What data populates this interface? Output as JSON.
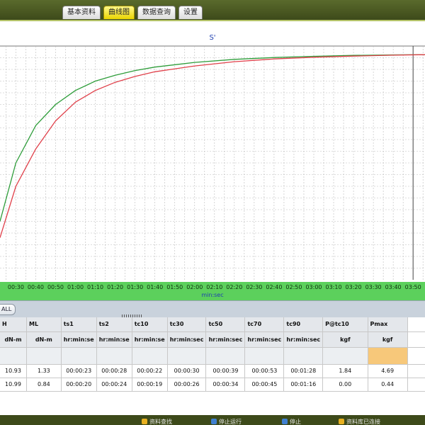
{
  "tabs": [
    {
      "label": "基本资料",
      "active": false
    },
    {
      "label": "曲线图",
      "active": true
    },
    {
      "label": "数据查询",
      "active": false
    },
    {
      "label": "设置",
      "active": false
    }
  ],
  "toolbar": {
    "all_label": "ALL"
  },
  "chart_data": {
    "type": "line",
    "title": "S'",
    "xlabel": "min:sec",
    "x_tick_labels": [
      "00:30",
      "00:40",
      "00:50",
      "01:00",
      "01:10",
      "01:20",
      "01:30",
      "01:40",
      "01:50",
      "02:00",
      "02:10",
      "02:20",
      "02:30",
      "02:40",
      "02:50",
      "03:00",
      "03:10",
      "03:20",
      "03:30",
      "03:40",
      "03:50"
    ],
    "xlim": [
      22,
      236
    ],
    "ylim": [
      0,
      100
    ],
    "grid": true,
    "vertical_marker_seconds": 230,
    "series": [
      {
        "color": "#2e9d3a",
        "x": [
          22,
          30,
          40,
          50,
          60,
          70,
          80,
          90,
          100,
          120,
          140,
          160,
          180,
          200,
          220,
          236
        ],
        "y": [
          25,
          50,
          66,
          75,
          81,
          85,
          87.5,
          89.5,
          91,
          93,
          94.3,
          95.1,
          95.6,
          96,
          96.2,
          96.3
        ]
      },
      {
        "color": "#e0404a",
        "x": [
          22,
          30,
          40,
          50,
          60,
          70,
          80,
          90,
          100,
          120,
          140,
          160,
          180,
          200,
          220,
          236
        ],
        "y": [
          18,
          40,
          56,
          68,
          76,
          81,
          84.5,
          87,
          89,
          91.5,
          93.3,
          94.5,
          95.2,
          95.7,
          96.1,
          96.3
        ]
      }
    ]
  },
  "table": {
    "headers": [
      "H",
      "ML",
      "ts1",
      "ts2",
      "tc10",
      "tc30",
      "tc50",
      "tc70",
      "tc90",
      "P@tc10",
      "Pmax"
    ],
    "units": [
      "dN-m",
      "dN-m",
      "hr:min:se",
      "hr:min:se",
      "hr:min:se",
      "hr:min:sec",
      "hr:min:sec",
      "hr:min:sec",
      "hr:min:sec",
      "kgf",
      "kgf"
    ],
    "rows": [
      [
        "10.93",
        "1.33",
        "00:00:23",
        "00:00:28",
        "00:00:22",
        "00:00:30",
        "00:00:39",
        "00:00:53",
        "00:01:28",
        "1.84",
        "4.69"
      ],
      [
        "10.99",
        "0.84",
        "00:00:20",
        "00:00:24",
        "00:00:19",
        "00:00:26",
        "00:00:34",
        "00:00:45",
        "00:01:16",
        "0.00",
        "0.44"
      ]
    ],
    "highlight_color": "#f7c87a"
  },
  "bottombar": [
    {
      "label": "资料查找",
      "icon": "table-icon",
      "color": "#e8b020"
    },
    {
      "label": "停止运行",
      "icon": "globe-icon",
      "color": "#3f7fd0"
    },
    {
      "label": "停止",
      "icon": "globe-icon",
      "color": "#3f7fd0"
    },
    {
      "label": "资料库已连接",
      "icon": "db-icon",
      "color": "#e8b020"
    }
  ]
}
